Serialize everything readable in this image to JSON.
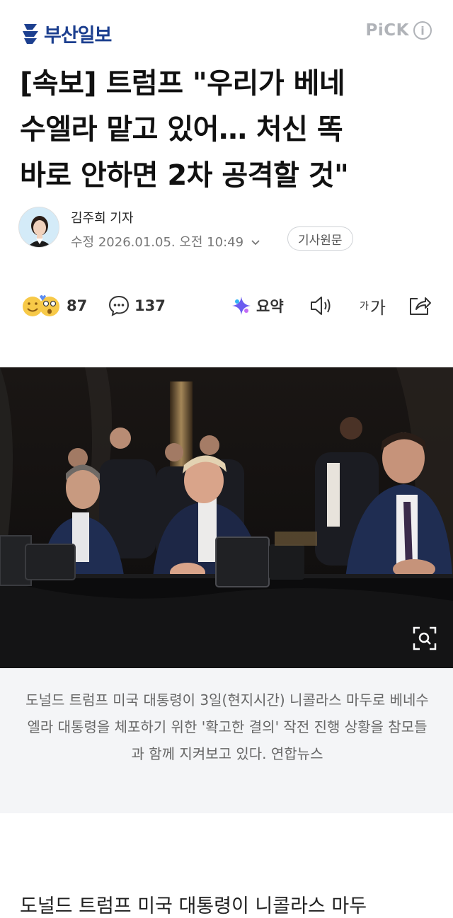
{
  "header": {
    "logo_text": "부산일보",
    "pick_label": "PiCK",
    "info_glyph": "i",
    "brand_color": "#1c3f8f"
  },
  "article": {
    "title_lines": [
      "[속보] 트럼프 \"우리가 베네",
      "수엘라 맡고 있어… 처신 똑",
      "바로 안하면 2차 공격할 것\""
    ],
    "author": "김주희 기자",
    "date": "수정 2026.01.05. 오전 10:49",
    "original_button": "기사원문",
    "caption": "도널드 트럼프 미국 대통령이 3일(현지시간) 니콜라스 마두로 베네수엘라 대통령을 체포하기 위한 '확고한 결의' 작전 진행 상황을 참모들과 함께 지켜보고 있다. 연합뉴스",
    "body_start": "도널드 트럼프 미국 대통령이 니콜라스 마두"
  },
  "actions": {
    "reactions_count": "87",
    "comments_count": "137",
    "summary_label": "요약",
    "font_small": "가",
    "font_large": "가"
  },
  "icons": [
    "logo-icon",
    "info-icon",
    "reaction-emoji-icon",
    "comment-icon",
    "summary-sparkle-icon",
    "tts-speaker-icon",
    "share-icon",
    "zoom-icon",
    "dropdown-chevron-icon"
  ]
}
